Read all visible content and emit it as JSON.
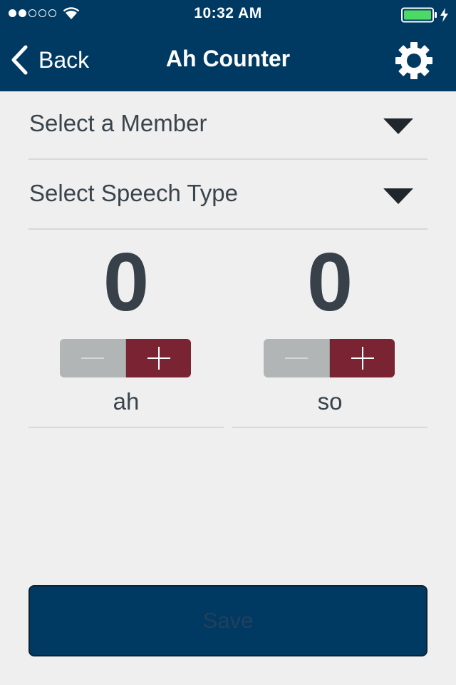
{
  "status_bar": {
    "time": "10:32 AM",
    "signal_bars_filled": 2,
    "signal_bars_total": 5,
    "battery_icon": "battery-charging-icon"
  },
  "nav": {
    "back_label": "Back",
    "title": "Ah Counter",
    "settings_icon": "gear-icon"
  },
  "selects": {
    "member": {
      "label": "Select a Member"
    },
    "speech_type": {
      "label": "Select Speech Type"
    }
  },
  "counters": [
    {
      "value": "0",
      "label": "ah"
    },
    {
      "value": "0",
      "label": "so"
    }
  ],
  "save_label": "Save",
  "colors": {
    "primary_navy": "#003a63",
    "plus_maroon": "#7a2332",
    "minus_gray": "#b1b5b5",
    "background": "#efefef"
  }
}
